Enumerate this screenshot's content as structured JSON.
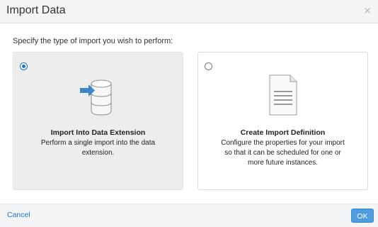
{
  "dialog": {
    "title": "Import Data",
    "close_icon": "close-icon"
  },
  "instruction": "Specify the type of import you wish to perform:",
  "options": [
    {
      "selected": true,
      "icon": "database-import-icon",
      "title": "Import Into Data Extension",
      "desc_lines": [
        "Perform a single import into the data",
        "extension."
      ]
    },
    {
      "selected": false,
      "icon": "document-icon",
      "title": "Create Import Definition",
      "desc_lines": [
        "Configure the properties for your import",
        "so that it can be scheduled for one or",
        "more future instances."
      ]
    }
  ],
  "footer": {
    "cancel_label": "Cancel",
    "ok_label": "OK"
  },
  "colors": {
    "accent": "#1a73c7",
    "ok_button": "#4d9de0",
    "selected_card": "#ededed"
  }
}
